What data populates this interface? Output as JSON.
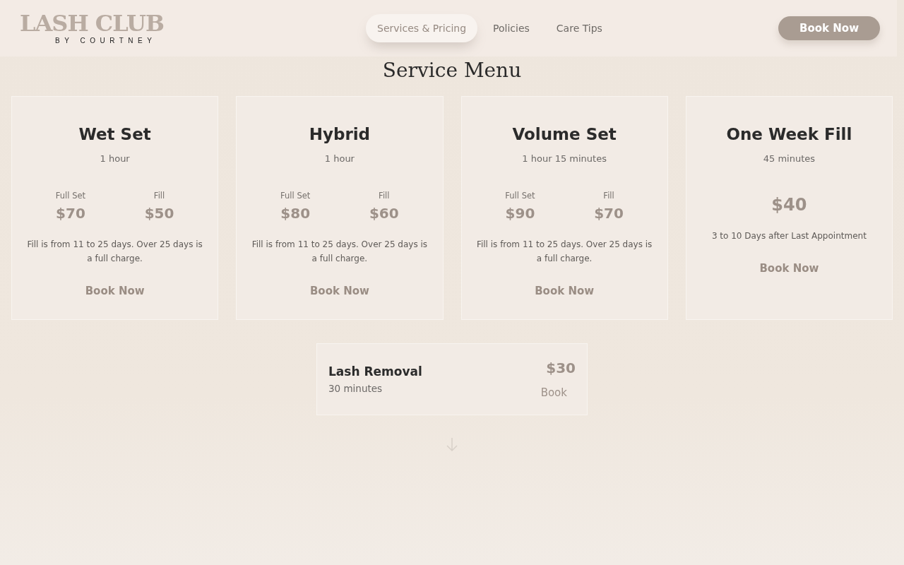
{
  "header": {
    "logo": {
      "title": "LASH CLUB",
      "subtitle": "BY COURTNEY"
    },
    "nav": [
      {
        "label": "Services & Pricing",
        "selected": true
      },
      {
        "label": "Policies",
        "selected": false
      },
      {
        "label": "Care Tips",
        "selected": false
      }
    ],
    "cta": "Book Now"
  },
  "heading": "Service Menu",
  "services": [
    {
      "kind": "split",
      "name": "Wet Set",
      "duration": "1 hour",
      "prices": [
        {
          "label": "Full Set",
          "price": "$70"
        },
        {
          "label": "Fill",
          "price": "$50"
        }
      ],
      "note": "Fill is from 11 to 25 days. Over 25 days is a full charge.",
      "button": "Book Now"
    },
    {
      "kind": "split",
      "name": "Hybrid",
      "duration": "1 hour",
      "prices": [
        {
          "label": "Full Set",
          "price": "$80"
        },
        {
          "label": "Fill",
          "price": "$60"
        }
      ],
      "note": "Fill is from 11 to 25 days. Over 25 days is a full charge.",
      "button": "Book Now"
    },
    {
      "kind": "split",
      "name": "Volume Set",
      "duration": "1 hour 15 minutes",
      "prices": [
        {
          "label": "Full Set",
          "price": "$90"
        },
        {
          "label": "Fill",
          "price": "$70"
        }
      ],
      "note": "Fill is from 11 to 25 days. Over 25 days is a full charge.",
      "button": "Book Now"
    },
    {
      "kind": "single",
      "name": "One Week Fill",
      "duration": "45 minutes",
      "price": "$40",
      "note": "3 to 10 Days after Last Appointment",
      "button": "Book Now"
    }
  ],
  "extra": {
    "name": "Lash Removal",
    "duration": "30 minutes",
    "price": "$30",
    "button": "Book"
  }
}
